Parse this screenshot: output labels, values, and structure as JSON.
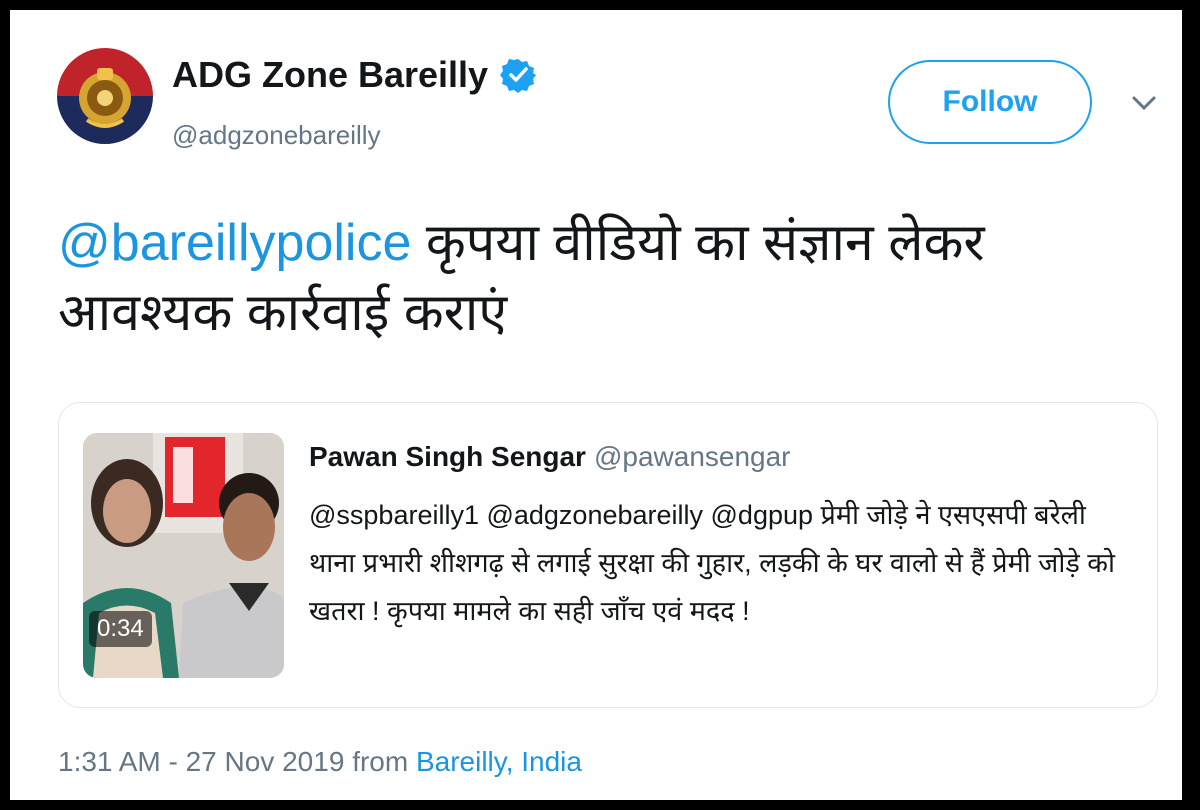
{
  "author": {
    "display_name": "ADG Zone Bareilly",
    "handle": "@adgzonebareilly",
    "verified_icon": "verified-badge-icon",
    "avatar_icon": "police-emblem-icon"
  },
  "actions": {
    "follow_label": "Follow",
    "menu_icon": "chevron-down-icon"
  },
  "tweet": {
    "mention": "@bareillypolice",
    "text": " कृपया वीडियो का संज्ञान लेकर आवश्यक कार्रवाई कराएं"
  },
  "quoted": {
    "name": "Pawan Singh Sengar",
    "handle": "@pawansengar",
    "text": "@sspbareilly1 @adgzonebareilly @dgpup  प्रेमी जोड़े ने एसएसपी बरेली थाना प्रभारी शीशगढ़ से लगाई सुरक्षा की गुहार, लड़की के घर वालो से हैं प्रेमी जोड़े को खतरा ! कृपया मामले का सही जाँच एवं मदद !",
    "video_duration": "0:34"
  },
  "meta": {
    "timestamp": "1:31 AM - 27 Nov 2019",
    "from_label": "from",
    "location": "Bareilly, India"
  },
  "colors": {
    "accent": "#1da1f2",
    "link": "#1b95e0",
    "text": "#14171a",
    "muted": "#657786",
    "border": "#e1e8ed"
  }
}
